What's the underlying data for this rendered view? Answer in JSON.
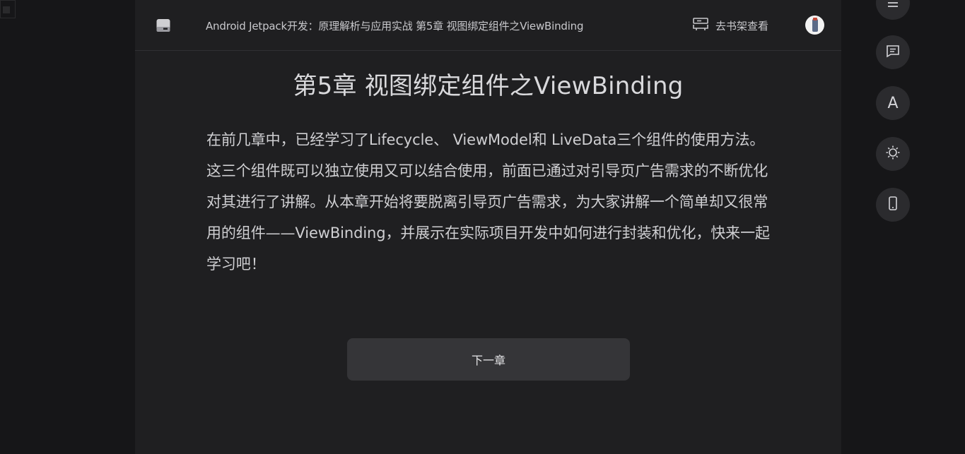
{
  "header": {
    "book_title": "Android Jetpack开发：原理解析与应用实战 第5章 视图绑定组件之ViewBinding",
    "shelf_label": "去书架查看"
  },
  "chapter": {
    "title": "第5章 视图绑定组件之ViewBinding",
    "paragraph": "在前几章中，已经学习了Lifecycle、 ViewModel和 LiveData三个组件的使用方法。这三个组件既可以独立使用又可以结合使用，前面已通过对引导页广告需求的不断优化对其进行了讲解。从本章开始将要脱离引导页广告需求，为大家讲解一个简单却又很常用的组件——ViewBinding，并展示在实际项目开发中如何进行封装和优化，快来一起学习吧！"
  },
  "next_chapter_label": "下一章",
  "sidebar": {
    "buttons": [
      {
        "icon": "menu-icon"
      },
      {
        "icon": "comment-icon"
      },
      {
        "icon": "font-icon",
        "glyph": "A"
      },
      {
        "icon": "brightness-icon"
      },
      {
        "icon": "phone-icon"
      }
    ]
  },
  "colors": {
    "page_bg": "#161618",
    "reader_bg": "#1f1f21",
    "text": "#cfcfd2",
    "button_bg": "#353538",
    "side_button_bg": "#2b2b2e"
  }
}
